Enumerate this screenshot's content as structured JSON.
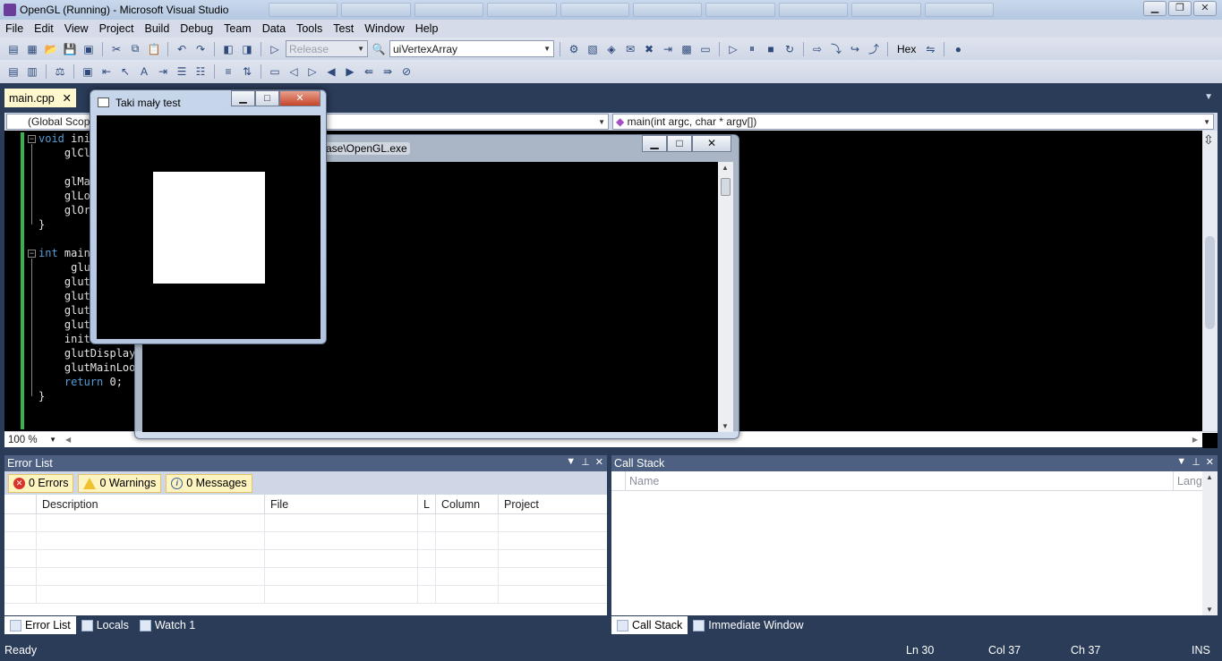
{
  "window": {
    "title": "OpenGL (Running) - Microsoft Visual Studio",
    "controls": {
      "minimize": "▁",
      "restore": "❐",
      "close": "✕"
    }
  },
  "menu": [
    "File",
    "Edit",
    "View",
    "Project",
    "Build",
    "Debug",
    "Team",
    "Data",
    "Tools",
    "Test",
    "Window",
    "Help"
  ],
  "toolbar": {
    "config_value": "Release",
    "find_value": "uiVertexArray",
    "hex_label": "Hex"
  },
  "doc_tab": {
    "label": "main.cpp",
    "close": "✕"
  },
  "nav": {
    "scope": "(Global Scope)",
    "member": "main(int argc, char * argv[])"
  },
  "code": [
    {
      "kw": "void",
      "text": " ini"
    },
    {
      "kw": "",
      "text": "    glCl"
    },
    {
      "kw": "",
      "text": ""
    },
    {
      "kw": "",
      "text": "    glMa"
    },
    {
      "kw": "",
      "text": "    glLo"
    },
    {
      "kw": "",
      "text": "    glOr"
    },
    {
      "kw": "",
      "text": "}"
    },
    {
      "kw": "",
      "text": ""
    },
    {
      "kw": "int",
      "text": " main"
    },
    {
      "kw": "",
      "text": "     glu"
    },
    {
      "kw": "",
      "text": "    glut"
    },
    {
      "kw": "",
      "text": "    glut"
    },
    {
      "kw": "",
      "text": "    glut"
    },
    {
      "kw": "",
      "text": "    glut"
    },
    {
      "kw": "",
      "text": "    init"
    },
    {
      "kw": "",
      "text": "    glutDisplay"
    },
    {
      "kw": "",
      "text": "    glutMainLoo"
    },
    {
      "kw": "return",
      "text": " 0;"
    },
    {
      "kw": "",
      "text": "}"
    }
  ],
  "editor_status": {
    "zoom": "100 %"
  },
  "console": {
    "title": "ase\\OpenGL.exe"
  },
  "gl_window": {
    "title": "Taki mały test"
  },
  "error_list": {
    "title": "Error List",
    "errors": "0 Errors",
    "warnings": "0 Warnings",
    "messages": "0 Messages",
    "columns": [
      "Description",
      "File",
      "L",
      "Column",
      "Project"
    ]
  },
  "left_tabs": [
    "Error List",
    "Locals",
    "Watch 1"
  ],
  "call_stack": {
    "title": "Call Stack",
    "columns": [
      "Name",
      "Lang"
    ]
  },
  "right_tabs": [
    "Call Stack",
    "Immediate Window"
  ],
  "status": {
    "ready": "Ready",
    "ln": "Ln 30",
    "col": "Col 37",
    "ch": "Ch 37",
    "ins": "INS"
  }
}
